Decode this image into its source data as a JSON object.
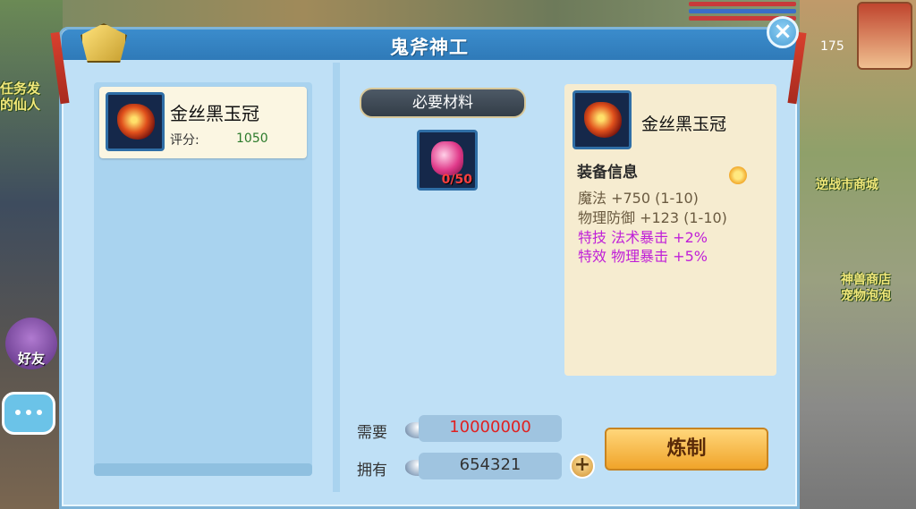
{
  "dialog": {
    "title": "鬼斧神工",
    "close_symbol": "×"
  },
  "item_list": [
    {
      "name": "金丝黑玉冠",
      "score_label": "评分:",
      "score_value": "1050"
    }
  ],
  "materials": {
    "banner": "必要材料",
    "items": [
      {
        "icon": "pink-stone-icon",
        "count": "0/50"
      }
    ]
  },
  "info": {
    "name": "金丝黑玉冠",
    "section_title": "装备信息",
    "stats": [
      {
        "text": "魔法   +750 (1-10)",
        "color": "#6a5a40"
      },
      {
        "text": "物理防御   +123 (1-10)",
        "color": "#6a5a40"
      },
      {
        "text": "特技  法术暴击   +2%",
        "color": "#c020d8"
      },
      {
        "text": "特效  物理暴击   +5%",
        "color": "#c020d8"
      }
    ]
  },
  "cost": {
    "need_label": "需要",
    "need_value": "10000000",
    "need_color": "#e02020",
    "have_label": "拥有",
    "have_value": "654321",
    "plus_symbol": "+"
  },
  "forge_button": "炼制",
  "hud": {
    "friend_label": "好友",
    "right_number": "175",
    "side_texts": [
      "任务发",
      "的仙人",
      "逆战市商城",
      "神兽商店",
      "宠物泡泡"
    ]
  }
}
